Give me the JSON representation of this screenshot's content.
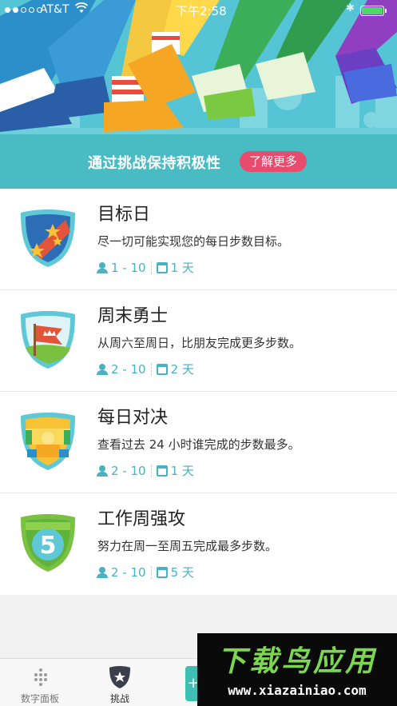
{
  "status_bar": {
    "carrier": "AT&T",
    "time": "下午2:58",
    "signal_bars_filled": 2,
    "signal_bars_total": 5,
    "battery_level": 1.0
  },
  "hero": {
    "text": "通过挑战保持积极性",
    "learn_more": "了解更多"
  },
  "challenges": [
    {
      "title": "目标日",
      "description": "尽一切可能实现您的每日步数目标。",
      "players": "1 - 10",
      "duration": "1 天",
      "badge": "stars-badge-icon"
    },
    {
      "title": "周末勇士",
      "description": "从周六至周日，比朋友完成更多步数。",
      "players": "2 - 10",
      "duration": "2 天",
      "badge": "flag-badge-icon"
    },
    {
      "title": "每日对决",
      "description": "查看过去 24 小时谁完成的步数最多。",
      "players": "2 - 10",
      "duration": "1 天",
      "badge": "sun-badge-icon"
    },
    {
      "title": "工作周强攻",
      "description": "努力在周一至周五完成最多步数。",
      "players": "2 - 10",
      "duration": "5 天",
      "badge": "five-badge-icon"
    }
  ],
  "tabbar": {
    "dashboard": "数字面板",
    "challenges": "挑战",
    "add": "+"
  },
  "watermark": {
    "title": "下载鸟应用",
    "url": "www.xiazainiao.com"
  },
  "colors": {
    "hero": "#55c5d6",
    "accent_pink": "#e94b6c",
    "meta_teal": "#48b1c2",
    "watermark_green": "#7cd651"
  }
}
